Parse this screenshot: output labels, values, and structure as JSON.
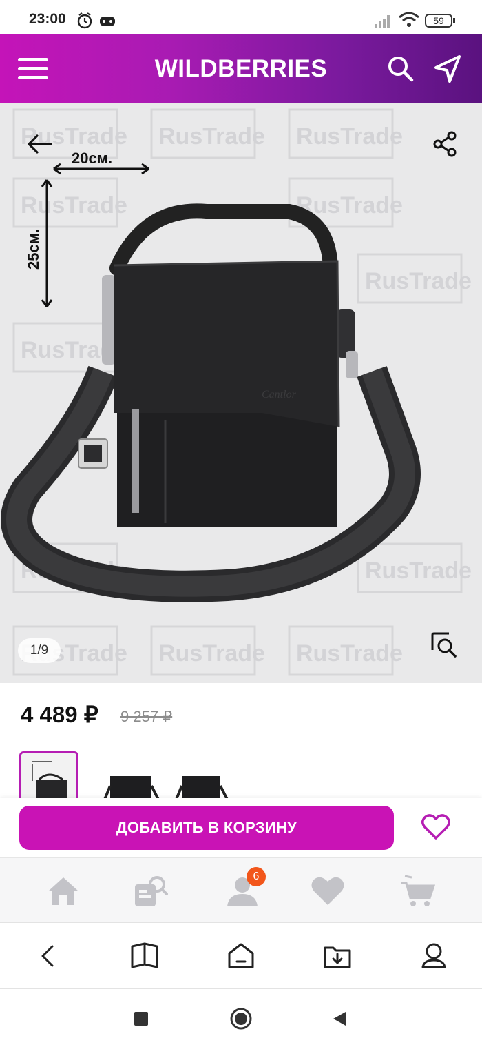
{
  "status_bar": {
    "time": "23:00",
    "battery": "59"
  },
  "header": {
    "brand": "WILDBERRIES"
  },
  "gallery": {
    "counter": "1/9",
    "width_label": "20см.",
    "height_label": "25см.",
    "watermark": "RusTrade"
  },
  "price": {
    "current": "4 489 ₽",
    "old": "9 257 ₽"
  },
  "cart": {
    "button_label": "ДОБАВИТЬ В КОРЗИНУ"
  },
  "tabs": {
    "profile_badge": "6"
  },
  "colors": {
    "brand_primary": "#c913b5",
    "brand_dark": "#5a127f",
    "badge": "#f2561b"
  }
}
